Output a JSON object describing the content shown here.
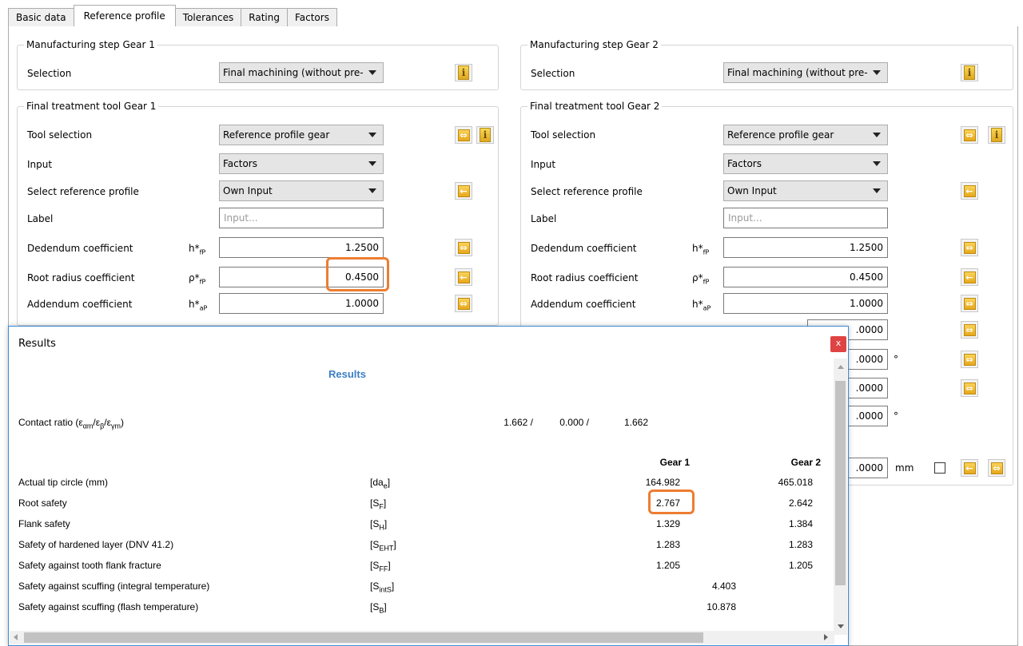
{
  "tabs": [
    "Basic data",
    "Reference profile",
    "Tolerances",
    "Rating",
    "Factors"
  ],
  "gear1": {
    "mfg_legend": "Manufacturing step Gear 1",
    "selection_label": "Selection",
    "selection_value": "Final machining (without pre-",
    "tool_legend": "Final treatment tool Gear 1",
    "tool_selection_label": "Tool selection",
    "tool_selection_value": "Reference profile gear",
    "input_label": "Input",
    "input_value": "Factors",
    "ref_profile_label": "Select reference profile",
    "ref_profile_value": "Own Input",
    "label_label": "Label",
    "label_placeholder": "Input...",
    "dedendum_label": "Dedendum coefficient",
    "dedendum_sym": "h*",
    "dedendum_sub": "fP",
    "dedendum_value": "1.2500",
    "root_radius_label": "Root radius coefficient",
    "root_radius_sym": "ρ*",
    "root_radius_sub": "fP",
    "root_radius_value": "0.4500",
    "addendum_label": "Addendum coefficient",
    "addendum_sym": "h*",
    "addendum_sub": "aP",
    "addendum_value": "1.0000"
  },
  "gear2": {
    "mfg_legend": "Manufacturing step Gear 2",
    "selection_label": "Selection",
    "selection_value": "Final machining (without pre-",
    "tool_legend": "Final treatment tool Gear 2",
    "tool_selection_label": "Tool selection",
    "tool_selection_value": "Reference profile gear",
    "input_label": "Input",
    "input_value": "Factors",
    "ref_profile_label": "Select reference profile",
    "ref_profile_value": "Own Input",
    "label_label": "Label",
    "label_placeholder": "Input...",
    "dedendum_label": "Dedendum coefficient",
    "dedendum_sym": "h*",
    "dedendum_sub": "fP",
    "dedendum_value": "1.2500",
    "root_radius_label": "Root radius coefficient",
    "root_radius_sym": "ρ*",
    "root_radius_sub": "fP",
    "root_radius_value": "0.4500",
    "addendum_label": "Addendum coefficient",
    "addendum_sym": "h*",
    "addendum_sub": "aP",
    "addendum_value": "1.0000",
    "partial_values": [
      ".0000",
      ".0000",
      ".0000",
      ".0000",
      ".0000"
    ],
    "unit_deg": "°",
    "unit_mm": "mm"
  },
  "results": {
    "window_title": "Results",
    "close_label": "x",
    "heading": "Results",
    "contact_ratio_label": "Contact ratio (ε",
    "contact_ratio_values": [
      "1.662 /",
      "0.000 /",
      "1.662"
    ],
    "gear1_header": "Gear 1",
    "gear2_header": "Gear 2",
    "rows": [
      {
        "label": "Actual tip circle (mm)",
        "sym": "[da",
        "sub": "e",
        "close": "]",
        "g1": "164.982",
        "g2": "465.018"
      },
      {
        "label": "Root safety",
        "sym": "[S",
        "sub": "F",
        "close": "]",
        "g1": "2.767",
        "g2": "2.642"
      },
      {
        "label": "Flank safety",
        "sym": "[S",
        "sub": "H",
        "close": "]",
        "g1": "1.329",
        "g2": "1.384"
      },
      {
        "label": "Safety of hardened layer (DNV 41.2)",
        "sym": "[S",
        "sub": "EHT",
        "close": "]",
        "g1": "1.283",
        "g2": "1.283"
      },
      {
        "label": "Safety against tooth flank fracture",
        "sym": "[S",
        "sub": "FF",
        "close": "]",
        "g1": "1.205",
        "g2": "1.205"
      },
      {
        "label": "Safety against scuffing (integral temperature)",
        "sym": "[S",
        "sub": "intS",
        "close": "]",
        "shared": "4.403"
      },
      {
        "label": "Safety against scuffing (flash temperature)",
        "sym": "[S",
        "sub": "B",
        "close": "]",
        "shared": "10.878"
      }
    ]
  },
  "colors": {
    "highlight": "#ed7d31",
    "accent": "#3c7fc4",
    "close": "#e04343"
  },
  "icons": [
    "info-icon",
    "double-arrow-icon",
    "arrow-left-icon",
    "dropdown-arrow-icon"
  ]
}
